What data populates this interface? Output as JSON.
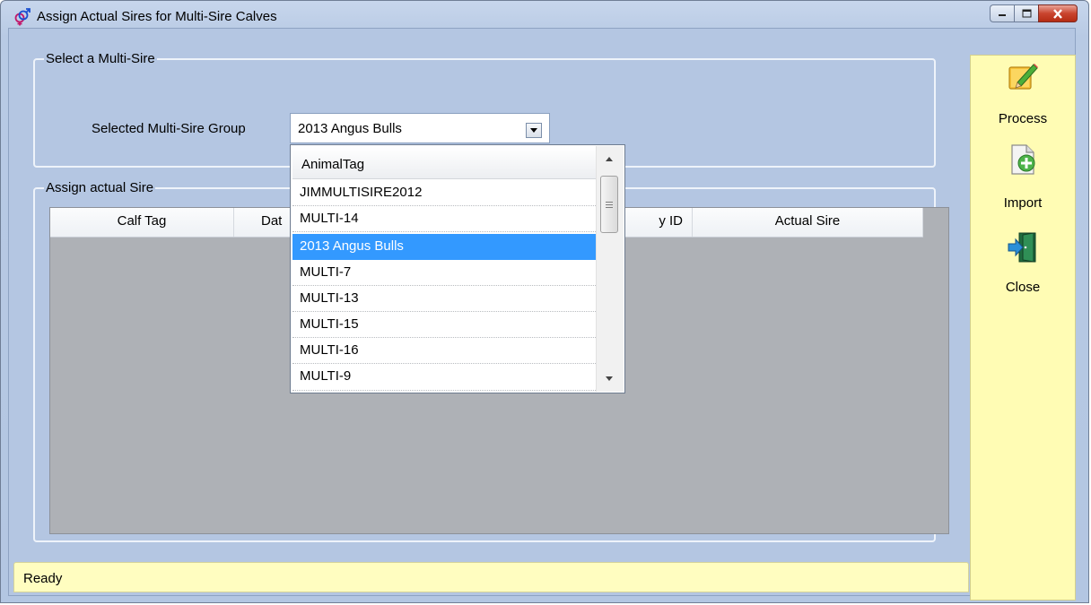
{
  "window": {
    "title": "Assign Actual Sires for Multi-Sire Calves"
  },
  "select_group": {
    "legend": "Select a Multi-Sire",
    "label": "Selected Multi-Sire Group",
    "selected_value": "2013 Angus Bulls"
  },
  "assign_group": {
    "legend": "Assign actual Sire",
    "columns": [
      "Calf Tag",
      "Dat",
      "y ID",
      "Actual Sire"
    ]
  },
  "dropdown": {
    "header": "AnimalTag",
    "items": [
      "JIMMULTISIRE2012",
      "MULTI-14",
      "2013 Angus Bulls",
      "MULTI-7",
      "MULTI-13",
      "MULTI-15",
      "MULTI-16",
      "MULTI-9"
    ],
    "selected_index": 2
  },
  "actions": {
    "process": "Process",
    "import": "Import",
    "close": "Close"
  },
  "status": {
    "text": "Ready"
  },
  "colors": {
    "window_bg": "#b4c6e2",
    "action_panel": "#fffcb4",
    "status_bar": "#fffdc0",
    "selection": "#3399ff"
  }
}
